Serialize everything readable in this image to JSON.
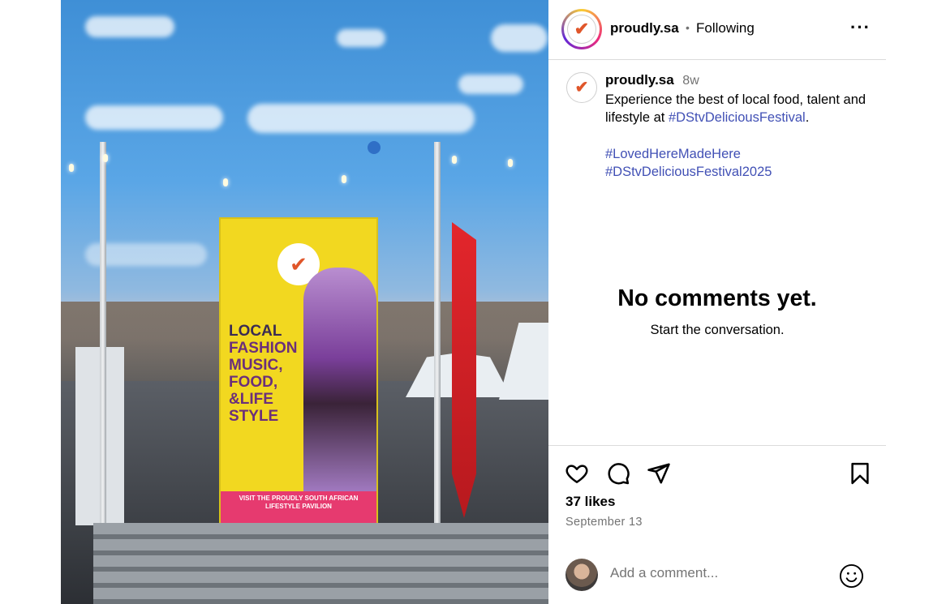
{
  "post": {
    "username": "proudly.sa",
    "follow_status": "Following",
    "separator": "•",
    "more_icon": "more-horizontal-icon",
    "caption_username": "proudly.sa",
    "caption_age": "8w",
    "caption_text_1": "Experience the best of local food, talent and lifestyle at ",
    "caption_hashtag_inline": "#DStvDeliciousFestival",
    "caption_text_end": ".",
    "hashtag_1": "#LovedHereMadeHere",
    "hashtag_2": "#DStvDeliciousFestival2025"
  },
  "comments": {
    "empty_title": "No comments yet.",
    "empty_subtitle": "Start the conversation."
  },
  "actions": {
    "like_icon": "heart-icon",
    "comment_icon": "comment-bubble-icon",
    "share_icon": "paper-plane-icon",
    "save_icon": "bookmark-icon",
    "likes": "37 likes",
    "date": "September 13"
  },
  "composer": {
    "placeholder": "Add a comment...",
    "emoji_icon": "smiley-icon"
  },
  "photo": {
    "banner_lines": [
      "LOCAL",
      "FASHION",
      "MUSIC,",
      "FOOD,",
      "&LIFE",
      "STYLE"
    ],
    "banner_bottom": "VISIT THE PROUDLY SOUTH AFRICAN LIFESTYLE PAVILION"
  },
  "colors": {
    "link": "#4150b5",
    "muted": "#737373",
    "banner_yellow": "#f2d820"
  }
}
